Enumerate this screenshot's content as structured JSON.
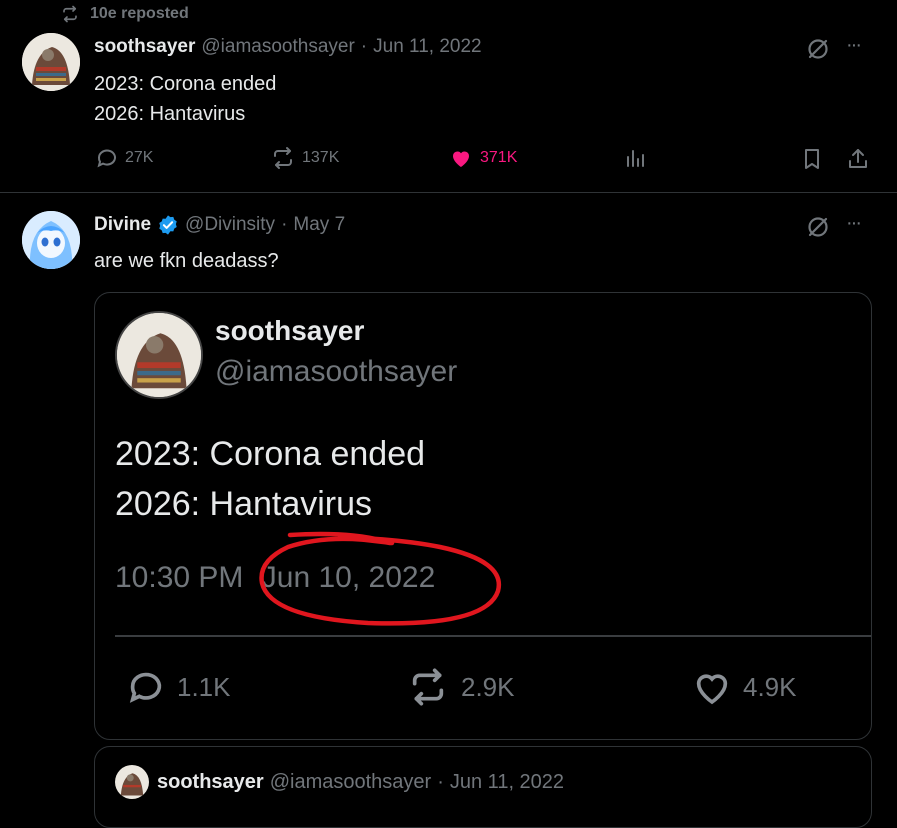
{
  "repost": {
    "label": "10e reposted"
  },
  "tweet1": {
    "name": "soothsayer",
    "handle": "@iamasoothsayer",
    "sep": "·",
    "date": "Jun 11, 2022",
    "lines": [
      "2023: Corona ended",
      "2026: Hantavirus"
    ],
    "replies": "27K",
    "reposts": "137K",
    "likes": "371K",
    "more": "···"
  },
  "tweet2": {
    "name": "Divine",
    "handle": "@Divinsity",
    "sep": "·",
    "date": "May 7",
    "text": "are we fkn deadass?",
    "more": "···"
  },
  "screenshot": {
    "name": "soothsayer",
    "handle": "@iamasoothsayer",
    "lines": [
      "2023: Corona ended",
      "2026: Hantavirus"
    ],
    "time": "10:30 PM",
    "date": "Jun 10, 2022",
    "replies": "1.1K",
    "reposts": "2.9K",
    "likes": "4.9K"
  },
  "quoted": {
    "name": "soothsayer",
    "handle": "@iamasoothsayer",
    "sep": "·",
    "date": "Jun 11, 2022"
  },
  "colors": {
    "like": "#f91880",
    "verified": "#1d9bf0",
    "annotation": "#e0161e"
  }
}
